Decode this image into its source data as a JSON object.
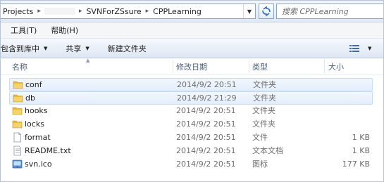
{
  "address": {
    "crumbs": [
      "Projects",
      "SVNForZSsure",
      "CPPLearning"
    ]
  },
  "search": {
    "placeholder": "搜索 CPPLearning"
  },
  "menu": {
    "items": [
      {
        "label": "工具(T)"
      },
      {
        "label": "帮助(H)"
      }
    ]
  },
  "toolbar": {
    "include_label": "包含到库中",
    "share_label": "共享",
    "new_folder_label": "新建文件夹"
  },
  "columns": {
    "name": "名称",
    "date": "修改日期",
    "type": "类型",
    "size": "大小"
  },
  "files": [
    {
      "name": "conf",
      "date": "2014/9/2 20:51",
      "type": "文件夹",
      "size": "",
      "icon": "folder-icon",
      "selected": true
    },
    {
      "name": "db",
      "date": "2014/9/2 21:29",
      "type": "文件夹",
      "size": "",
      "icon": "folder-icon",
      "selected": true
    },
    {
      "name": "hooks",
      "date": "2014/9/2 20:51",
      "type": "文件夹",
      "size": "",
      "icon": "folder-icon",
      "selected": false
    },
    {
      "name": "locks",
      "date": "2014/9/2 20:51",
      "type": "文件夹",
      "size": "",
      "icon": "folder-icon",
      "selected": false
    },
    {
      "name": "format",
      "date": "2014/9/2 20:51",
      "type": "文件",
      "size": "1 KB",
      "icon": "file-icon",
      "selected": false
    },
    {
      "name": "README.txt",
      "date": "2014/9/2 20:51",
      "type": "文本文档",
      "size": "1 KB",
      "icon": "text-file-icon",
      "selected": false
    },
    {
      "name": "svn.ico",
      "date": "2014/9/2 20:51",
      "type": "图标",
      "size": "177 KB",
      "icon": "ico-file-icon",
      "selected": false
    }
  ],
  "colors": {
    "folder": "#e8b83c",
    "selection_border": "#c9dcf2",
    "header_text": "#4c607a"
  }
}
